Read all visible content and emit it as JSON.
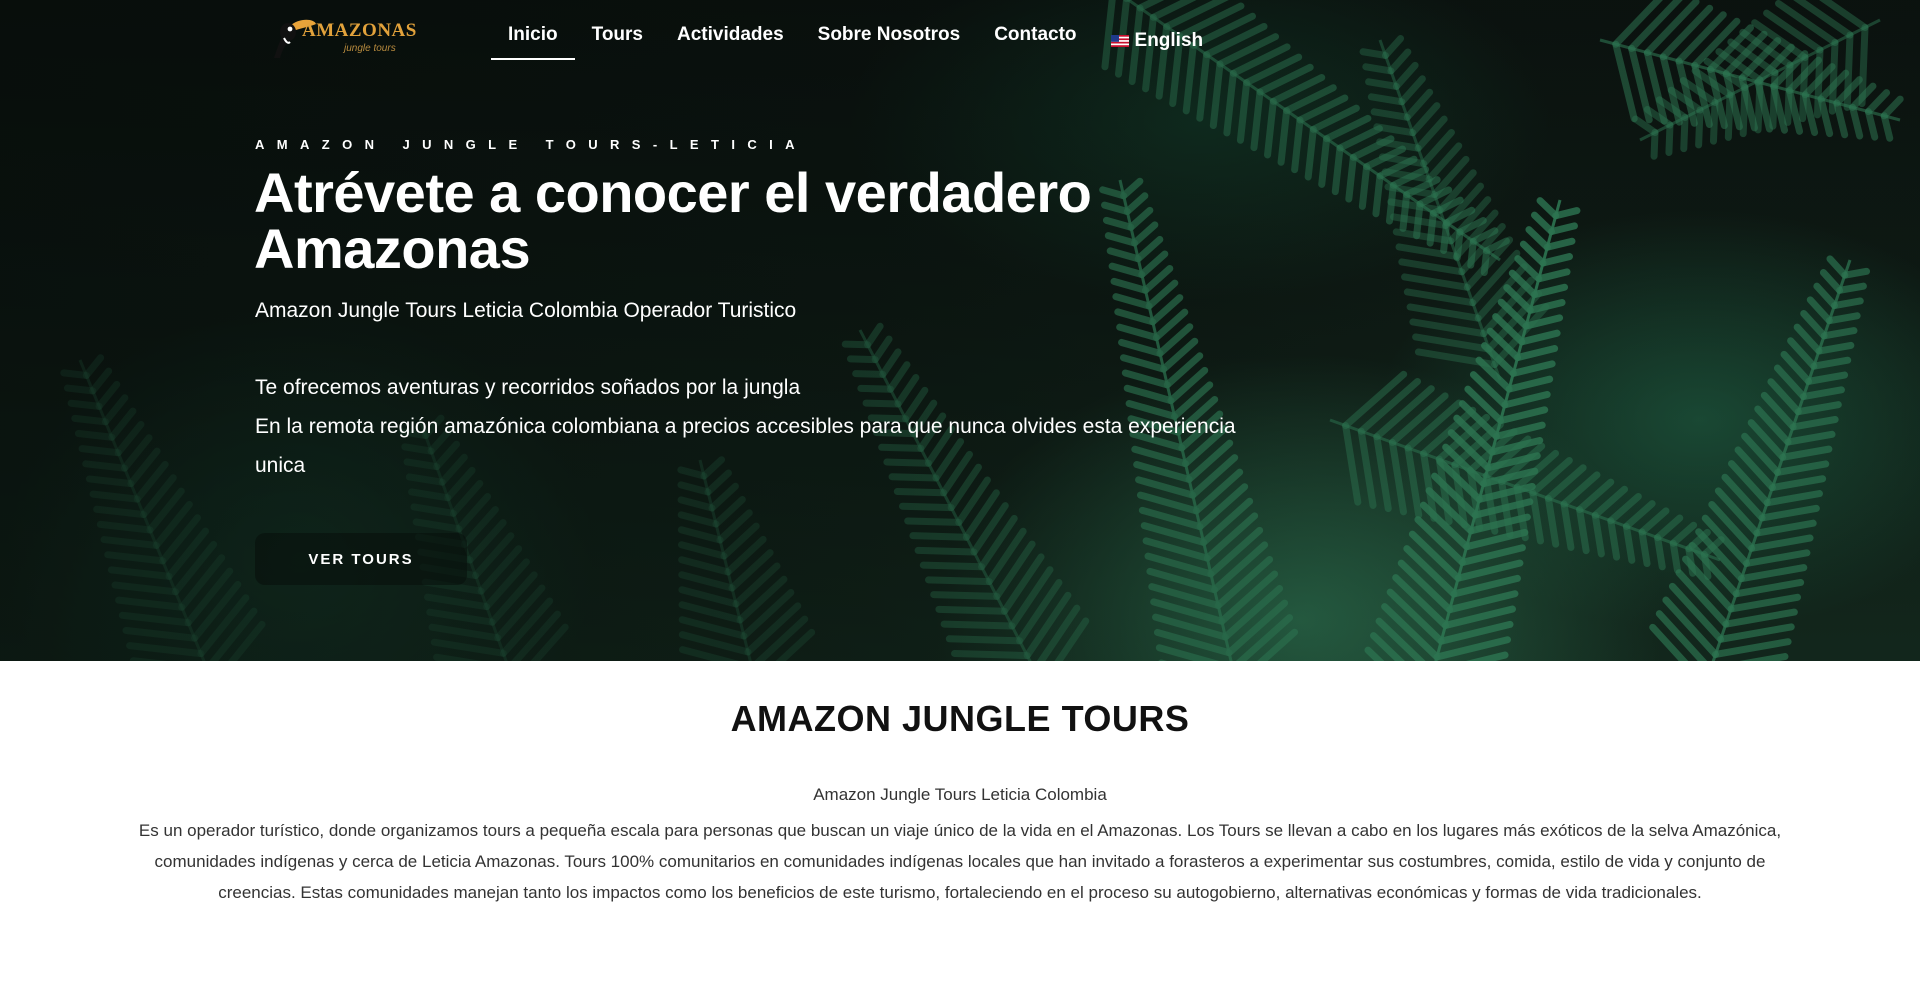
{
  "header": {
    "logo": {
      "title": "AMAZONAS",
      "subtitle": "jungle tours"
    },
    "nav": [
      {
        "label": "Inicio",
        "active": true
      },
      {
        "label": "Tours",
        "active": false
      },
      {
        "label": "Actividades",
        "active": false
      },
      {
        "label": "Sobre Nosotros",
        "active": false
      },
      {
        "label": "Contacto",
        "active": false
      },
      {
        "label": "English",
        "active": false,
        "icon": "us-flag-icon"
      }
    ]
  },
  "hero": {
    "eyebrow": "AMAZON JUNGLE TOURS-LETICIA",
    "title": "Atrévete a conocer el verdadero Amazonas",
    "subtitle": "Amazon Jungle Tours Leticia Colombia Operador Turistico",
    "body_lines": [
      "Te ofrecemos aventuras y recorridos soñados por la jungla",
      "En la remota región amazónica colombiana a precios accesibles para que nunca olvides esta experiencia unica"
    ],
    "cta_label": "VER TOURS"
  },
  "intro": {
    "title": "AMAZON JUNGLE TOURS",
    "subtitle": "Amazon Jungle Tours Leticia Colombia",
    "body": "Es un operador turístico, donde organizamos tours a pequeña escala para personas que buscan un viaje único de la vida en el Amazonas. Los Tours se llevan a cabo en los lugares más exóticos de la selva Amazónica, comunidades indígenas y cerca de Leticia Amazonas. Tours 100% comunitarios en comunidades indígenas locales que han invitado a forasteros a experimentar sus costumbres, comida, estilo de vida y conjunto de creencias. Estas comunidades manejan tanto los impactos como los beneficios de este turismo, fortaleciendo en el proceso su autogobierno, alternativas económicas y formas de vida tradicionales."
  },
  "colors": {
    "logo_gold": "#e2a23b",
    "hero_dark": "#0b120f",
    "fern_green": "#2f7a55",
    "text_dark": "#111111"
  }
}
